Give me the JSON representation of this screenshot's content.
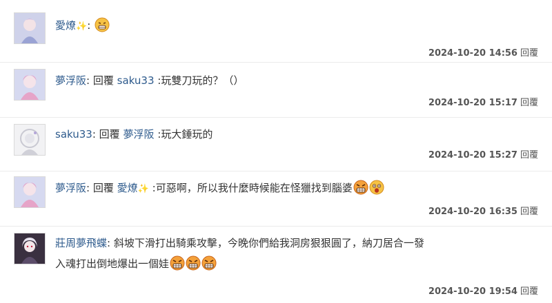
{
  "comments": [
    {
      "user": "愛燎",
      "colon": ":",
      "reply_word": "",
      "reply_to": "",
      "text": "",
      "timestamp": "2024-10-20 14:56",
      "reply_label": "回覆"
    },
    {
      "user": "夢浮阪",
      "colon": ":",
      "reply_word": "回覆",
      "reply_to": "saku33",
      "text": ":玩雙刀玩的？（）",
      "timestamp": "2024-10-20 15:17",
      "reply_label": "回覆"
    },
    {
      "user": "saku33",
      "colon": ":",
      "reply_word": "回覆",
      "reply_to": "夢浮阪",
      "text": ":玩大錘玩的",
      "timestamp": "2024-10-20 15:27",
      "reply_label": "回覆"
    },
    {
      "user": "夢浮阪",
      "colon": ":",
      "reply_word": "回覆",
      "reply_to": "愛燎",
      "text": ":可惡啊，所以我什麼時候能在怪獵找到腦婆",
      "timestamp": "2024-10-20 16:35",
      "reply_label": "回覆"
    },
    {
      "user": "莊周夢飛蝶",
      "colon": ":",
      "text": "斜坡下滑打出騎乘攻擊，今晚你們給我洞房狠狠圓了，納刀居合一發",
      "text2": "入魂打出倒地爆出一個娃",
      "timestamp": "2024-10-20 19:54",
      "reply_label": "回覆"
    }
  ],
  "icons": {
    "sparkle": "sparkles-icon",
    "grin": "grinning-emoji",
    "angry": "grimacing-angry-emoji",
    "shocked": "shocked-emoji"
  }
}
